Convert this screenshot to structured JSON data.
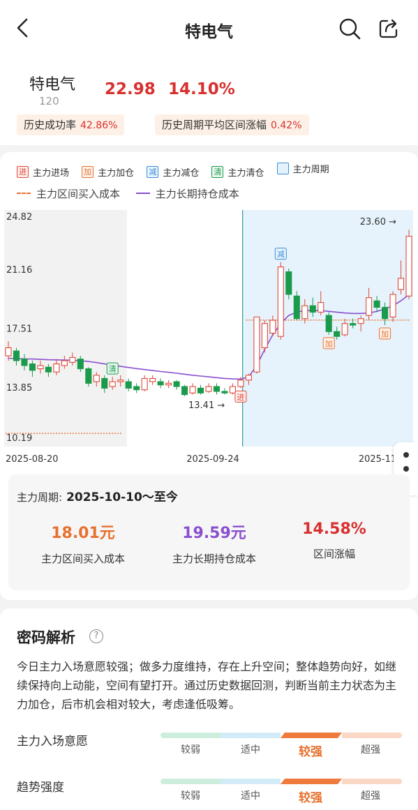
{
  "header": {
    "back_label": "返回",
    "title": "特电气"
  },
  "stock": {
    "name": "特电气",
    "code": "120",
    "price": "22.98",
    "change_pct": "14.10%",
    "tags": [
      {
        "label": "历史成功率",
        "value": "42.86%"
      },
      {
        "label": "历史周期平均区间涨幅",
        "value": "0.42%"
      }
    ]
  },
  "legend": {
    "markers": [
      {
        "glyph": "进",
        "label": "主力进场",
        "color": "#e04a3a"
      },
      {
        "glyph": "加",
        "label": "主力加仓",
        "color": "#e77130"
      },
      {
        "glyph": "减",
        "label": "主力减仓",
        "color": "#3a8fd8"
      },
      {
        "glyph": "清",
        "label": "主力清仓",
        "color": "#1a9b4b"
      },
      {
        "glyph": "",
        "label": "主力周期",
        "color": "#3a8fd8"
      }
    ],
    "lines": [
      {
        "label": "主力区间买入成本",
        "color": "#e77130"
      },
      {
        "label": "主力长期持仓成本",
        "color": "#8a4fd0"
      }
    ]
  },
  "chart_data": {
    "type": "candlestick",
    "y_ticks": [
      "24.82",
      "21.16",
      "17.51",
      "13.85",
      "10.19"
    ],
    "ylim": [
      10.19,
      24.82
    ],
    "x_ticks": [
      "2025-08-20",
      "2025-09-24",
      "2025-11"
    ],
    "annotations": {
      "high": "23.60",
      "low": "13.41"
    },
    "signals": [
      {
        "glyph": "清",
        "index": 13
      },
      {
        "glyph": "进",
        "index": 29
      },
      {
        "glyph": "减",
        "index": 34
      },
      {
        "glyph": "加",
        "index": 40
      },
      {
        "glyph": "加",
        "index": 47
      }
    ],
    "candles": [
      {
        "o": 15.8,
        "c": 16.3,
        "h": 16.7,
        "l": 15.5
      },
      {
        "o": 16.1,
        "c": 15.5,
        "h": 16.3,
        "l": 15.2
      },
      {
        "o": 15.6,
        "c": 15.2,
        "h": 15.9,
        "l": 14.9
      },
      {
        "o": 15.3,
        "c": 14.9,
        "h": 15.5,
        "l": 14.5
      },
      {
        "o": 15.0,
        "c": 15.2,
        "h": 15.5,
        "l": 14.7
      },
      {
        "o": 15.1,
        "c": 14.8,
        "h": 15.3,
        "l": 14.5
      },
      {
        "o": 14.8,
        "c": 15.3,
        "h": 15.6,
        "l": 14.6
      },
      {
        "o": 15.2,
        "c": 15.5,
        "h": 15.8,
        "l": 15.0
      },
      {
        "o": 15.4,
        "c": 15.7,
        "h": 16.0,
        "l": 15.2
      },
      {
        "o": 15.6,
        "c": 15.0,
        "h": 15.8,
        "l": 14.8
      },
      {
        "o": 15.0,
        "c": 14.1,
        "h": 15.1,
        "l": 13.9
      },
      {
        "o": 14.2,
        "c": 14.6,
        "h": 14.8,
        "l": 13.9
      },
      {
        "o": 14.4,
        "c": 13.8,
        "h": 14.6,
        "l": 13.5
      },
      {
        "o": 13.9,
        "c": 14.2,
        "h": 14.5,
        "l": 13.7
      },
      {
        "o": 14.2,
        "c": 14.3,
        "h": 14.6,
        "l": 13.9
      },
      {
        "o": 14.2,
        "c": 13.8,
        "h": 14.4,
        "l": 13.6
      },
      {
        "o": 13.9,
        "c": 13.7,
        "h": 14.1,
        "l": 13.5
      },
      {
        "o": 13.7,
        "c": 14.4,
        "h": 14.6,
        "l": 13.6
      },
      {
        "o": 14.2,
        "c": 14.4,
        "h": 14.6,
        "l": 14.0
      },
      {
        "o": 14.2,
        "c": 14.0,
        "h": 14.4,
        "l": 13.8
      },
      {
        "o": 14.0,
        "c": 14.1,
        "h": 14.3,
        "l": 13.8
      },
      {
        "o": 14.2,
        "c": 13.9,
        "h": 14.3,
        "l": 13.7
      },
      {
        "o": 13.9,
        "c": 13.4,
        "h": 14.0,
        "l": 13.3
      },
      {
        "o": 13.5,
        "c": 13.9,
        "h": 14.1,
        "l": 13.4
      },
      {
        "o": 13.8,
        "c": 13.5,
        "h": 14.0,
        "l": 13.4
      },
      {
        "o": 13.6,
        "c": 13.9,
        "h": 14.1,
        "l": 13.5
      },
      {
        "o": 13.9,
        "c": 13.6,
        "h": 14.1,
        "l": 13.4
      },
      {
        "o": 13.6,
        "c": 13.5,
        "h": 13.8,
        "l": 13.4
      },
      {
        "o": 13.5,
        "c": 13.9,
        "h": 14.1,
        "l": 13.4
      },
      {
        "o": 13.9,
        "c": 14.3,
        "h": 14.5,
        "l": 13.8
      },
      {
        "o": 14.3,
        "c": 14.6,
        "h": 14.7,
        "l": 14.0
      },
      {
        "o": 14.8,
        "c": 18.2,
        "h": 18.2,
        "l": 14.7
      },
      {
        "o": 16.3,
        "c": 17.8,
        "h": 18.0,
        "l": 16.0
      },
      {
        "o": 17.2,
        "c": 18.0,
        "h": 18.3,
        "l": 17.0
      },
      {
        "o": 17.0,
        "c": 21.3,
        "h": 21.6,
        "l": 16.8
      },
      {
        "o": 21.0,
        "c": 19.6,
        "h": 21.2,
        "l": 19.3
      },
      {
        "o": 19.5,
        "c": 18.1,
        "h": 19.8,
        "l": 18.0
      },
      {
        "o": 18.1,
        "c": 18.9,
        "h": 19.3,
        "l": 17.8
      },
      {
        "o": 18.9,
        "c": 18.5,
        "h": 19.4,
        "l": 18.2
      },
      {
        "o": 18.5,
        "c": 19.1,
        "h": 19.8,
        "l": 18.3
      },
      {
        "o": 18.3,
        "c": 17.3,
        "h": 18.5,
        "l": 17.1
      },
      {
        "o": 17.3,
        "c": 17.0,
        "h": 17.6,
        "l": 16.8
      },
      {
        "o": 17.1,
        "c": 17.8,
        "h": 18.1,
        "l": 17.0
      },
      {
        "o": 17.8,
        "c": 17.7,
        "h": 18.1,
        "l": 17.5
      },
      {
        "o": 17.8,
        "c": 18.1,
        "h": 18.3,
        "l": 17.3
      },
      {
        "o": 18.3,
        "c": 19.4,
        "h": 20.0,
        "l": 18.0
      },
      {
        "o": 19.2,
        "c": 18.8,
        "h": 19.5,
        "l": 18.5
      },
      {
        "o": 18.8,
        "c": 18.1,
        "h": 19.1,
        "l": 17.7
      },
      {
        "o": 18.2,
        "c": 19.6,
        "h": 19.8,
        "l": 17.9
      },
      {
        "o": 19.9,
        "c": 20.6,
        "h": 21.7,
        "l": 19.6
      },
      {
        "o": 19.5,
        "c": 23.2,
        "h": 23.6,
        "l": 19.3
      }
    ],
    "long_cost": [
      15.65,
      15.63,
      15.61,
      15.6,
      15.58,
      15.56,
      15.55,
      15.54,
      15.52,
      15.5,
      15.45,
      15.38,
      15.3,
      15.22,
      15.15,
      15.08,
      15.01,
      14.95,
      14.89,
      14.83,
      14.78,
      14.72,
      14.66,
      14.6,
      14.55,
      14.5,
      14.45,
      14.4,
      14.37,
      14.36,
      14.5,
      15.2,
      16.2,
      17.1,
      17.8,
      18.3,
      18.5,
      18.6,
      18.6,
      18.6,
      18.55,
      18.5,
      18.45,
      18.42,
      18.42,
      18.45,
      18.55,
      18.7,
      18.9,
      19.2,
      19.59
    ],
    "range_cost_segments": [
      {
        "from": 0,
        "to": 14,
        "value": 11.0
      },
      {
        "from": 30,
        "to": 50,
        "value": 18.01
      }
    ],
    "cycle_start_index": 30
  },
  "period": {
    "label": "主力周期:",
    "value": "2025-10-10～至今"
  },
  "stats": [
    {
      "value": "18.01元",
      "label": "主力区间买入成本",
      "color": "#e77130"
    },
    {
      "value": "19.59元",
      "label": "主力长期持仓成本",
      "color": "#8a4fd0"
    },
    {
      "value": "14.58%",
      "label": "区间涨幅",
      "color": "#d8302f"
    }
  ],
  "analysis": {
    "title": "密码解析",
    "text": "今日主力入场意愿较强；做多力度维持，存在上升空间；整体趋势向好，如继续保持向上动能，空间有望打开。通过历史数据回测，判断当前主力状态为主力加仓，后市机会相对较大，考虑逢低吸筹。",
    "meters": [
      {
        "label": "主力入场意愿",
        "levels": [
          "较弱",
          "适中",
          "较强",
          "超强"
        ],
        "active": 2
      },
      {
        "label": "趋势强度",
        "levels": [
          "较弱",
          "适中",
          "较强",
          "超强"
        ],
        "active": 2
      }
    ]
  }
}
